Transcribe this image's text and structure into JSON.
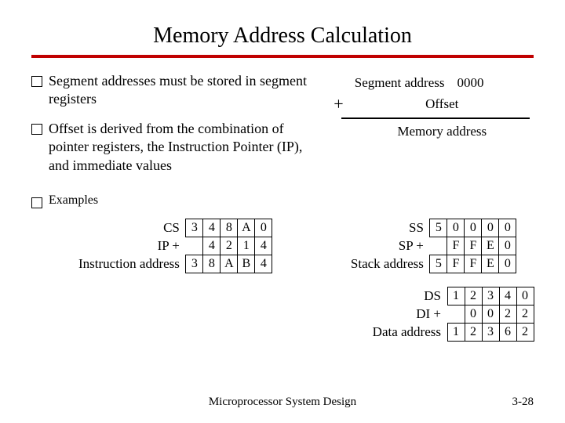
{
  "slide": {
    "title": "Memory Address Calculation",
    "bullets": [
      "Segment addresses must be stored in segment registers",
      "Offset is derived from the combination of pointer registers, the Instruction Pointer (IP), and immediate values",
      "Examples"
    ],
    "diagram": {
      "seg_label": "Segment address",
      "seg_zeros": "0000",
      "plus": "+",
      "offset_label": "Offset",
      "result_label": "Memory address"
    },
    "examples": {
      "cs": {
        "row1_label": "CS",
        "row1": [
          "3",
          "4",
          "8",
          "A",
          "0"
        ],
        "row2_label": "IP  +",
        "row2": [
          "",
          "4",
          "2",
          "1",
          "4"
        ],
        "row3_label": "Instruction address",
        "row3": [
          "3",
          "8",
          "A",
          "B",
          "4"
        ]
      },
      "ss": {
        "row1_label": "SS",
        "row1": [
          "5",
          "0",
          "0",
          "0",
          "0"
        ],
        "row2_label": "SP  +",
        "row2": [
          "",
          "F",
          "F",
          "E",
          "0"
        ],
        "row3_label": "Stack address",
        "row3": [
          "5",
          "F",
          "F",
          "E",
          "0"
        ]
      },
      "ds": {
        "row1_label": "DS",
        "row1": [
          "1",
          "2",
          "3",
          "4",
          "0"
        ],
        "row2_label": "DI  +",
        "row2": [
          "",
          "0",
          "0",
          "2",
          "2"
        ],
        "row3_label": "Data address",
        "row3": [
          "1",
          "2",
          "3",
          "6",
          "2"
        ]
      }
    },
    "footer": "Microprocessor System Design",
    "pagenum": "3-28"
  }
}
